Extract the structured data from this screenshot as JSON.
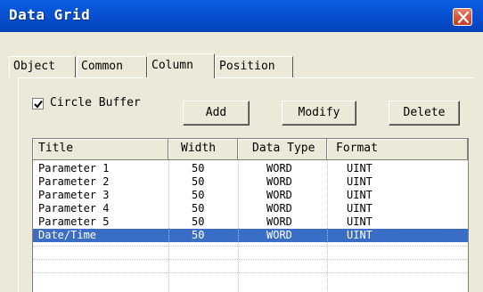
{
  "window": {
    "title": "Data Grid"
  },
  "tabs": [
    {
      "label": "Object",
      "active": false
    },
    {
      "label": "Common",
      "active": false
    },
    {
      "label": "Column",
      "active": true
    },
    {
      "label": "Position",
      "active": false
    }
  ],
  "options": {
    "circle_buffer_label": "Circle Buffer",
    "circle_buffer_checked": true
  },
  "buttons": {
    "add": "Add",
    "modify": "Modify",
    "delete": "Delete"
  },
  "grid": {
    "columns": [
      "Title",
      "Width",
      "Data Type",
      "Format"
    ],
    "rows": [
      {
        "title": "Parameter 1",
        "width": "50",
        "type": "WORD",
        "format": "UINT",
        "selected": false
      },
      {
        "title": "Parameter 2",
        "width": "50",
        "type": "WORD",
        "format": "UINT",
        "selected": false
      },
      {
        "title": "Parameter 3",
        "width": "50",
        "type": "WORD",
        "format": "UINT",
        "selected": false
      },
      {
        "title": "Parameter 4",
        "width": "50",
        "type": "WORD",
        "format": "UINT",
        "selected": false
      },
      {
        "title": "Parameter 5",
        "width": "50",
        "type": "WORD",
        "format": "UINT",
        "selected": false
      },
      {
        "title": "Date/Time",
        "width": "50",
        "type": "WORD",
        "format": "UINT",
        "selected": true
      }
    ]
  },
  "colors": {
    "titlebar": "#0853d4",
    "selection": "#3a6ec6",
    "face": "#ece9d8",
    "close": "#d6573c"
  }
}
